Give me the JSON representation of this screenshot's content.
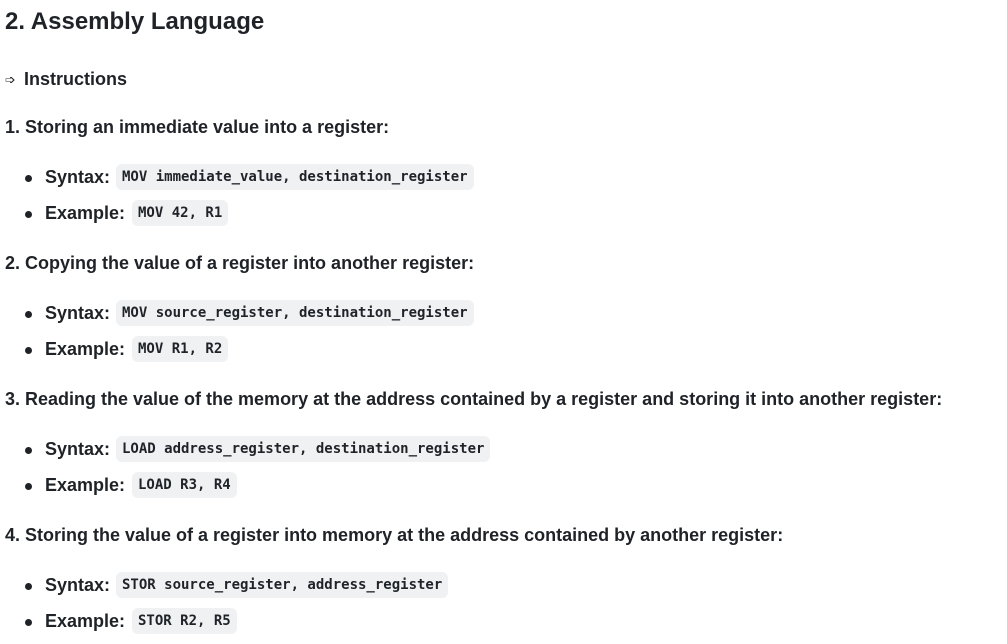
{
  "document": {
    "title": "2. Assembly Language",
    "instructions_arrow": "➩",
    "instructions_heading": "Instructions",
    "steps": [
      {
        "heading": "1. Storing an immediate value into a register:",
        "syntax_label": "Syntax:",
        "syntax_code": "MOV immediate_value, destination_register",
        "example_label": "Example:",
        "example_code": "MOV 42, R1"
      },
      {
        "heading": "2. Copying the value of a register into another register:",
        "syntax_label": "Syntax:",
        "syntax_code": "MOV source_register, destination_register",
        "example_label": "Example:",
        "example_code": "MOV R1, R2"
      },
      {
        "heading": "3. Reading the value of the memory at the address contained by a register and storing it into another register:",
        "syntax_label": "Syntax:",
        "syntax_code": "LOAD address_register, destination_register",
        "example_label": "Example:",
        "example_code": "LOAD R3, R4"
      },
      {
        "heading": "4. Storing the value of a register into memory at the address contained by another register:",
        "syntax_label": "Syntax:",
        "syntax_code": "STOR source_register, address_register",
        "example_label": "Example:",
        "example_code": "STOR R2, R5"
      }
    ]
  }
}
